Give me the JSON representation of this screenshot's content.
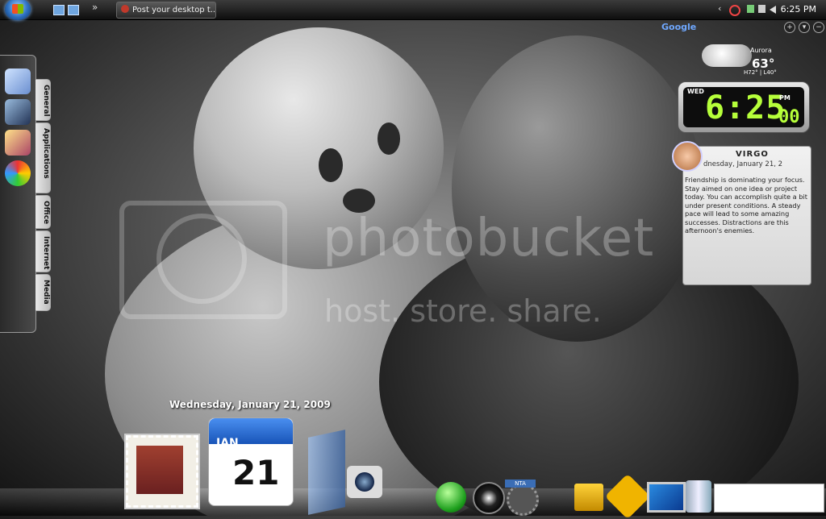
{
  "taskbar": {
    "task_title": "Post your desktop t...",
    "clock": "6:25 PM",
    "overflow_glyph": "»",
    "tray_glyph": "‹"
  },
  "watermark": {
    "line1": "photobucket",
    "line2": "host. store. share."
  },
  "left_dock": {
    "tabs": [
      "General",
      "Applications",
      "Office",
      "Internet",
      "Media"
    ]
  },
  "google_bar": {
    "logo": "Google",
    "buttons": [
      "+",
      "▾",
      "−"
    ]
  },
  "weather": {
    "city": "Aurora",
    "temperature": "63°",
    "high_low": "H72° | L40°"
  },
  "clock_gadget": {
    "day": "WED",
    "time": "6:25",
    "ampm": "PM",
    "seconds": "00"
  },
  "horoscope": {
    "sign": "VIRGO",
    "date": "dnesday, January 21, 2",
    "text": "Friendship is dominating your focus. Stay aimed on one idea or project today. You can accomplish quite a bit under present conditions. A steady pace will lead to some amazing successes. Distractions are this afternoon's enemies."
  },
  "desktop": {
    "date": "Wednesday, January 21, 2009"
  },
  "calendar_icon": {
    "month": "JAN",
    "day": "21"
  },
  "dock_badge": "NTA",
  "colors": {
    "clock_digits": "#b6ff3a",
    "calendar_header": "#1854b8"
  }
}
